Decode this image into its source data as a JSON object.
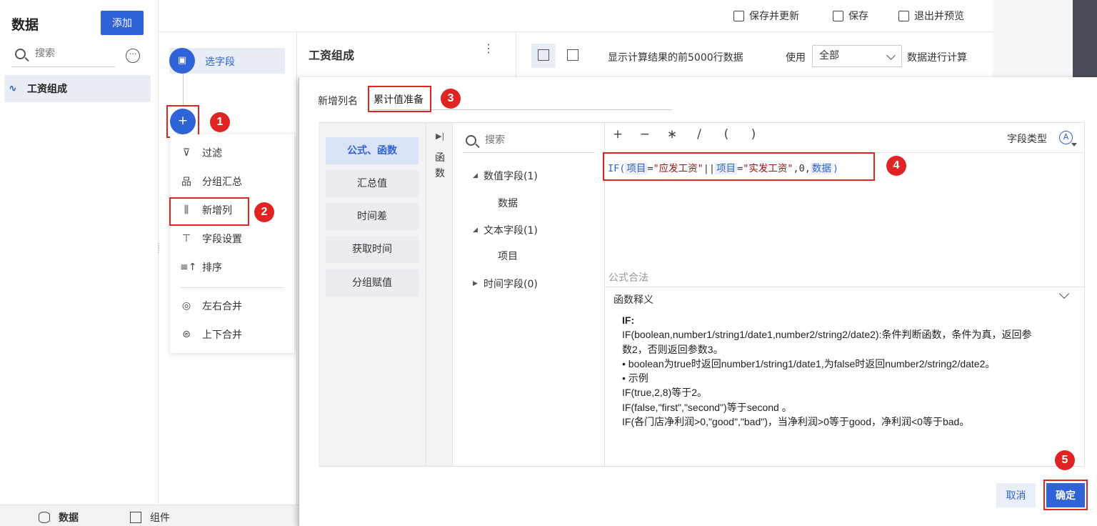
{
  "left_panel": {
    "title": "数据",
    "add_label": "添加",
    "search_placeholder": "搜索",
    "item_label": "工资组成"
  },
  "bottom_tabs": {
    "data": "数据",
    "component": "组件"
  },
  "toolbar": {
    "save_update": "保存并更新",
    "save": "保存",
    "exit_preview": "退出并预览"
  },
  "steps": {
    "select_field": "选字段",
    "plus": "+",
    "menu": {
      "filter": "过滤",
      "group": "分组汇总",
      "new_column": "新增列",
      "field_settings": "字段设置",
      "sort": "排序",
      "lr_merge": "左右合并",
      "ud_merge": "上下合并"
    }
  },
  "table_header": {
    "title": "工资组成",
    "info": "显示计算结果的前5000行数据",
    "use_label": "使用",
    "use_value": "全部",
    "calc_label": "数据进行计算"
  },
  "dialog": {
    "name_label": "新增列名",
    "name_value": "累计值准备",
    "categories": [
      "公式、函数",
      "汇总值",
      "时间差",
      "获取时间",
      "分组赋值"
    ],
    "fn_tab_chars": [
      "函",
      "数"
    ],
    "field_search_placeholder": "搜索",
    "groups": {
      "numeric": "数值字段(1)",
      "numeric_leaf": "数据",
      "text": "文本字段(1)",
      "text_leaf": "项目",
      "time": "时间字段(0)"
    },
    "operators": [
      "+",
      "−",
      "∗",
      "/",
      "(",
      ")"
    ],
    "field_type_label": "字段类型",
    "field_type_icon": "Ⓐ",
    "formula": {
      "fn_open": "IF(",
      "field1": "项目",
      "eq1": "=",
      "str1": "\"应发工资\"",
      "or": "||",
      "field2": "项目",
      "eq2": "=",
      "str2": "\"实发工资\"",
      "mid": ",0,",
      "field3": "数据",
      "close": ")"
    },
    "valid_text": "公式合法",
    "explain_title": "函数释义",
    "explain_lines": [
      "IF:",
      "IF(boolean,number1/string1/date1,number2/string2/date2):条件判断函数，条件为真，返回参",
      "数2，否则返回参数3。",
      "• boolean为true时返回number1/string1/date1,为false时返回number2/string2/date2。",
      "• 示例",
      "IF(true,2,8)等于2。",
      "IF(false,\"first\",\"second\")等于second 。",
      "IF(各门店净利润>0,\"good\",\"bad\")，当净利润>0等于good，净利润<0等于bad。"
    ],
    "cancel_label": "取消",
    "ok_label": "确定"
  },
  "badges": [
    "1",
    "2",
    "3",
    "4",
    "5"
  ],
  "colors": {
    "accent": "#2f63d8",
    "highlight": "#e02424"
  }
}
